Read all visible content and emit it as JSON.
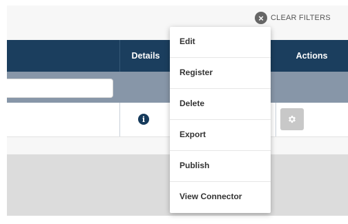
{
  "toolbar": {
    "clear_filters_label": "CLEAR FILTERS",
    "clear_icon": "close-circle-icon"
  },
  "table": {
    "headers": {
      "details": "Details",
      "actions": "Actions"
    },
    "filter_row": {
      "name_filter_value": ""
    },
    "rows": [
      {
        "details_icon": "info-icon",
        "actions_icon": "gear-icon"
      }
    ]
  },
  "context_menu": {
    "items": [
      {
        "label": "Edit"
      },
      {
        "label": "Register"
      },
      {
        "label": "Delete"
      },
      {
        "label": "Export"
      },
      {
        "label": "Publish"
      },
      {
        "label": "View Connector"
      }
    ]
  },
  "colors": {
    "header_bg": "#1b3e5e",
    "filter_row_bg": "#8796a8",
    "info_icon": "#163a5b",
    "gear_button_bg": "#c8c8c8"
  }
}
